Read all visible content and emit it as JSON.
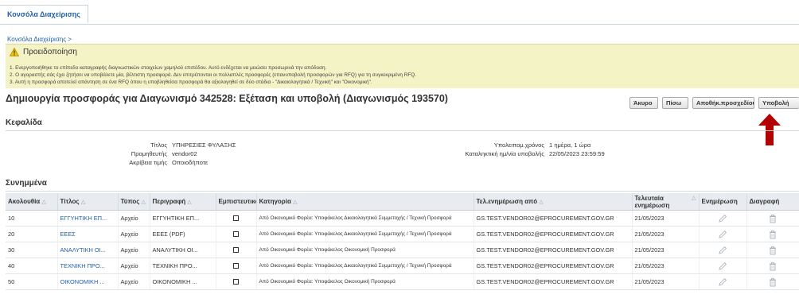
{
  "tabs": [
    {
      "label": "Κονσόλα Διαχείρισης"
    }
  ],
  "breadcrumb": "Κονσόλα Διαχείρισης >",
  "warning": {
    "title": "Προειδοποίηση",
    "lines": [
      "1. Ενεργοποιήθηκε το επίπεδο καταγραφής διαγνωστικών στοιχείων χαμηλού επιπέδου. Αυτό ενδέχεται να μειώσει προσωρινά την απόδοση.",
      "2. Ο αγοραστής σάς έχει ζητήσει να υποβάλετε μία, βέλτιστη προσφορά. Δεν επιτρέπονται οι πολλαπλές προσφορές (επανυποβολή προσφορών για RFQ) για τη συγκεκριμένη RFQ.",
      "3. Αυτή η προσφορά αποτελεί απάντηση σε ένα RFQ όπου η υποβληθείσα προσφορά θα αξιολογηθεί σε δύο στάδια - \"Δικαιολογητικά / Τεχνική\" και \"Οικονομική\"."
    ]
  },
  "page_title": "Δημιουργία προσφοράς για Διαγωνισμό 342528: Εξέταση και υποβολή (Διαγωνισμός 193570)",
  "buttons": {
    "cancel": "Άκυρο",
    "back": "Πίσω",
    "save_draft": "Αποθήκ.προσχεδίου",
    "submit": "Υποβολή"
  },
  "header_section": {
    "title": "Κεφαλίδα",
    "fields": {
      "title_label": "Τίτλος",
      "title_value": "ΥΠΗΡΕΣΙΕΣ ΦΥΛΑΞΗΣ",
      "supplier_label": "Προμηθευτής",
      "supplier_value": "vendor02",
      "precision_label": "Ακρίβεια τιμής",
      "precision_value": "Οποιοδήποτε",
      "remaining_label": "Υπολειπομ.χρόνος",
      "remaining_value": "1 ημέρα, 1 ώρα",
      "deadline_label": "Καταληκτική ημ/νία υποβολής",
      "deadline_value": "22/05/2023 23:59:59"
    }
  },
  "attachments": {
    "title": "Συνημμένα",
    "columns": {
      "seq": "Ακολουθία",
      "title": "Τίτλος",
      "type": "Τύπος",
      "desc": "Περιγραφή",
      "confidential": "Εμπιστευτικό",
      "category": "Κατηγορία",
      "updated_by": "Τελ.ενημέρωση από",
      "last_updated": "Τελευταία ενημέρωση",
      "update": "Ενημέρωση",
      "delete": "Διαγραφή"
    },
    "rows": [
      {
        "seq": "10",
        "title": "ΕΓΓΥΗΤΙΚΗ ΕΠ...",
        "type": "Αρχείο",
        "desc": "ΕΓΓΥΗΤΙΚΗ ΕΠ...",
        "category": "Από Οικονομικό Φορέα: Υποφάκελος Δικαιολογητικά Συμμετοχής / Τεχνική Προσφορά",
        "updated_by": "GS.TEST.VENDOR02@EPROCUREMENT.GOV.GR",
        "last_updated": "21/05/2023"
      },
      {
        "seq": "20",
        "title": "ΕΕΕΣ",
        "type": "Αρχείο",
        "desc": "ΕΕΕΣ (PDF)",
        "category": "Από Οικονομικό Φορέα: Υποφάκελος Δικαιολογητικά Συμμετοχής / Τεχνική Προσφορά",
        "updated_by": "GS.TEST.VENDOR02@EPROCUREMENT.GOV.GR",
        "last_updated": "21/05/2023"
      },
      {
        "seq": "30",
        "title": "ΑΝΑΛΥΤΙΚΗ ΟΙ...",
        "type": "Αρχείο",
        "desc": "ΑΝΑΛΥΤΙΚΗ ΟΙ...",
        "category": "Από Οικονομικό Φορέα: Υποφάκελος Οικονομική Προσφορά",
        "updated_by": "GS.TEST.VENDOR02@EPROCUREMENT.GOV.GR",
        "last_updated": "21/05/2023"
      },
      {
        "seq": "40",
        "title": "ΤΕΧΝΙΚΗ ΠΡΟ...",
        "type": "Αρχείο",
        "desc": "ΤΕΧΝΙΚΗ ΠΡΟ...",
        "category": "Από Οικονομικό Φορέα: Υποφάκελος Δικαιολογητικά Συμμετοχής / Τεχνική Προσφορά",
        "updated_by": "GS.TEST.VENDOR02@EPROCUREMENT.GOV.GR",
        "last_updated": "21/05/2023"
      },
      {
        "seq": "50",
        "title": "ΟΙΚΟΝΟΜΙΚΗ ...",
        "type": "Αρχείο",
        "desc": "ΟΙΚΟΝΟΜΙΚΗ ...",
        "category": "Από Οικονομικό Φορέα: Υποφάκελος Οικονομική Προσφορά",
        "updated_by": "GS.TEST.VENDOR02@EPROCUREMENT.GOV.GR",
        "last_updated": "21/05/2023"
      }
    ]
  },
  "colors": {
    "link": "#1f5fa8",
    "warning_bg": "#f4f3c6",
    "arrow": "#b30000",
    "header_bg": "#e8ecf0"
  }
}
